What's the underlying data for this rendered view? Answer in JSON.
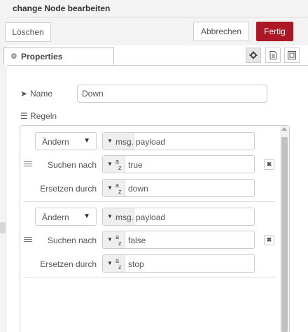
{
  "window": {
    "title": "change Node bearbeiten"
  },
  "toolbar": {
    "delete_label": "Löschen",
    "cancel_label": "Abbrechen",
    "done_label": "Fertig"
  },
  "tabs": [
    {
      "label": "Properties",
      "icon": "gear-icon"
    }
  ],
  "tab_buttons": [
    {
      "icon": "gear-icon",
      "active": true
    },
    {
      "icon": "description-icon"
    },
    {
      "icon": "appearance-icon"
    }
  ],
  "form": {
    "name_label": "Name",
    "name_value": "Down",
    "rules_label": "Regeln"
  },
  "rules": [
    {
      "action": "Ändern",
      "prefix": "msg.",
      "property": "payload",
      "search_label": "Suchen nach",
      "search_type": "a z",
      "search_value": "true",
      "replace_label": "Ersetzen durch",
      "replace_type": "a z",
      "replace_value": "down"
    },
    {
      "action": "Ändern",
      "prefix": "msg.",
      "property": "payload",
      "search_label": "Suchen nach",
      "search_type": "a z",
      "search_value": "false",
      "replace_label": "Ersetzen durch",
      "replace_type": "a z",
      "replace_value": "stop"
    }
  ],
  "colors": {
    "done_button": "#ad1625",
    "border": "#cccccc"
  }
}
